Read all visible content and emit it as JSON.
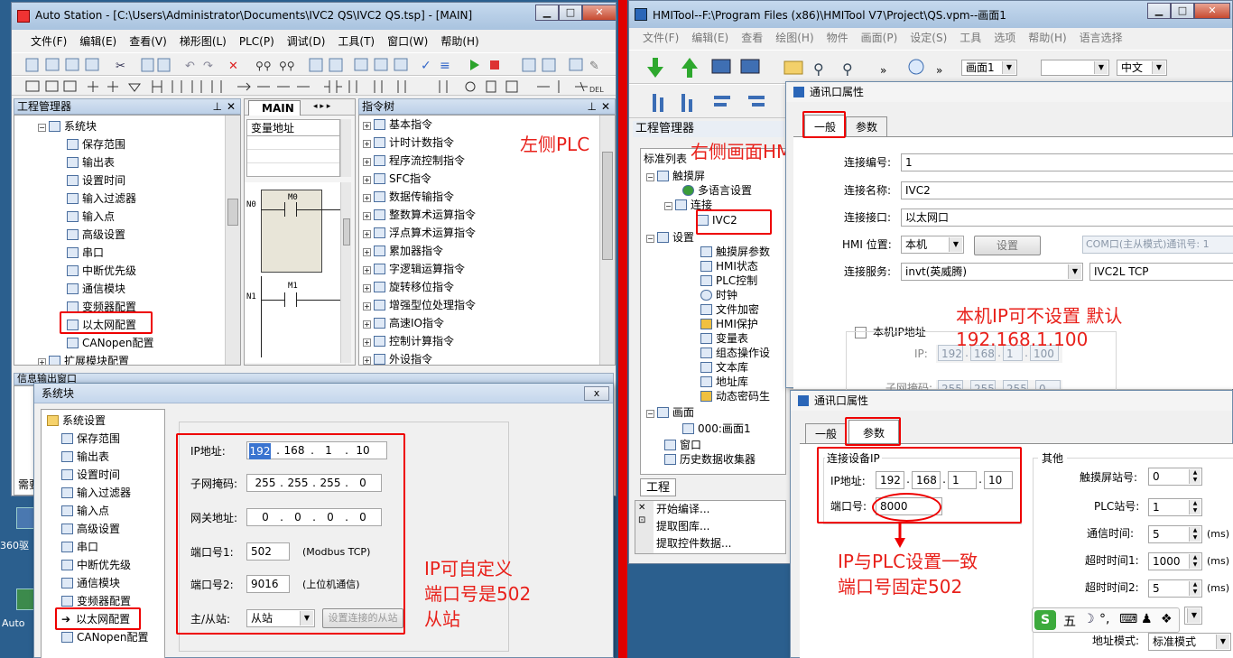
{
  "desktop": {
    "labels": [
      "360驱",
      "Auto"
    ]
  },
  "left_window": {
    "title": "Auto Station - [C:\\Users\\Administrator\\Documents\\IVC2 QS\\IVC2 QS.tsp] - [MAIN]",
    "menu": [
      "文件(F)",
      "编辑(E)",
      "查看(V)",
      "梯形图(L)",
      "PLC(P)",
      "调试(D)",
      "工具(T)",
      "窗口(W)",
      "帮助(H)"
    ],
    "project_panel_title": "工程管理器",
    "project_tree": [
      "系统块",
      "保存范围",
      "输出表",
      "设置时间",
      "输入过滤器",
      "输入点",
      "高级设置",
      "串口",
      "中断优先级",
      "通信模块",
      "变频器配置",
      "以太网配置",
      "CANopen配置",
      "扩展模块配置"
    ],
    "main_tab": "MAIN",
    "var_header": "变量地址",
    "ladder": {
      "rung0": "N0",
      "rung1": "N1",
      "contact0": "M0",
      "contact1": "M1"
    },
    "instr_panel_title": "指令树",
    "instr_tree": [
      "基本指令",
      "计时计数指令",
      "程序流控制指令",
      "SFC指令",
      "数据传输指令",
      "整数算术运算指令",
      "浮点算术运算指令",
      "累加器指令",
      "字逻辑运算指令",
      "旋转移位指令",
      "增强型位处理指令",
      "高速IO指令",
      "控制计算指令",
      "外设指令"
    ],
    "output_panel_title": "信息输出窗口",
    "output_partial": "需要"
  },
  "left_dialog": {
    "title": "系统块",
    "close": "x",
    "tree_root": "系统设置",
    "tree": [
      "保存范围",
      "输出表",
      "设置时间",
      "输入过滤器",
      "输入点",
      "高级设置",
      "串口",
      "中断优先级",
      "通信模块",
      "变频器配置",
      "以太网配置",
      "CANopen配置"
    ],
    "ip_label": "IP地址:",
    "ip": [
      "192",
      "168",
      "1",
      "10"
    ],
    "mask_label": "子网掩码:",
    "mask": [
      "255",
      "255",
      "255",
      "0"
    ],
    "gw_label": "网关地址:",
    "gw": [
      "0",
      "0",
      "0",
      "0"
    ],
    "port1_label": "端口号1:",
    "port1": "502",
    "port1_note": "(Modbus TCP)",
    "port2_label": "端口号2:",
    "port2": "9016",
    "port2_note": "(上位机通信)",
    "role_label": "主/从站:",
    "role": "从站",
    "role_btn": "设置连接的从站"
  },
  "right_window": {
    "title": "HMITool--F:\\Program Files (x86)\\HMITool V7\\Project\\QS.vpm--画面1",
    "menu": [
      "文件(F)",
      "编辑(E)",
      "查看",
      "绘图(H)",
      "物件",
      "画面(P)",
      "设定(S)",
      "工具",
      "选项",
      "帮助(H)",
      "语言选择"
    ],
    "screen_combo": "画面1",
    "lang_combo": "中文",
    "project_panel_title": "工程管理器",
    "std_list": "标准列表",
    "tree": [
      "触摸屏",
      "多语言设置",
      "连接",
      "IVC2",
      "设置",
      "触摸屏参数",
      "HMI状态",
      "PLC控制",
      "时钟",
      "文件加密",
      "HMI保护",
      "变量表",
      "组态操作设",
      "文本库",
      "地址库",
      "动态密码生",
      "画面",
      "000:画面1",
      "窗口",
      "历史数据收集器"
    ],
    "bottom_tab": "工程",
    "output_lines": [
      "开始编译...",
      "提取图库...",
      "提取控件数据..."
    ]
  },
  "comm_dialog_general": {
    "title": "通讯口属性",
    "tabs": [
      "一般",
      "参数"
    ],
    "conn_no_label": "连接编号:",
    "conn_no": "1",
    "conn_name_label": "连接名称:",
    "conn_name": "IVC2",
    "conn_port_label": "连接接口:",
    "conn_port": "以太网口",
    "hmi_pos_label": "HMI 位置:",
    "hmi_pos": "本机",
    "set_btn": "设置",
    "com_info": "COM口(主从模式)通讯号: 1",
    "service_label": "连接服务:",
    "service": "invt(英威腾)",
    "service_model": "IVC2L TCP",
    "local_ip_check": "本机IP地址",
    "ip_label": "IP:",
    "ip": [
      "192",
      "168",
      "1",
      "100"
    ],
    "mask_label": "子网掩码:",
    "mask": [
      "255",
      "255",
      "255",
      "0"
    ]
  },
  "comm_dialog_params": {
    "title": "通讯口属性",
    "tabs": [
      "一般",
      "参数"
    ],
    "group_dev_ip": "连接设备IP",
    "ip_label": "IP地址:",
    "ip": [
      "192",
      "168",
      "1",
      "10"
    ],
    "port_label": "端口号:",
    "port": "8000",
    "group_other": "其他",
    "hmi_station_label": "触摸屏站号:",
    "hmi_station": "0",
    "plc_station_label": "PLC站号:",
    "plc_station": "1",
    "comm_time_label": "通信时间:",
    "comm_time": "5",
    "unit": "(ms)",
    "timeout1_label": "超时时间1:",
    "timeout1": "1000",
    "timeout2_label": "超时时间2:",
    "timeout2": "5",
    "addr_mode_label": "地址模式:",
    "addr_mode": "标准模式"
  },
  "annotations": {
    "left_plc": "左侧PLC",
    "right_hmi": "右侧画面HMI",
    "local_ip_1": "本机IP可不设置 默认",
    "local_ip_2": "192.168.1.100",
    "ip_custom_1": "IP可自定义",
    "ip_custom_2": "端口号是502",
    "ip_custom_3": "从站",
    "same_1": "IP与PLC设置一致",
    "same_2": "端口号固定502"
  },
  "ime_bar": {
    "logo": "S",
    "items": [
      "五",
      "☽",
      "°,",
      "⌨",
      "♟",
      "❖"
    ]
  },
  "colors": {
    "annotation": "#e8211b",
    "divider": "#e00000"
  }
}
